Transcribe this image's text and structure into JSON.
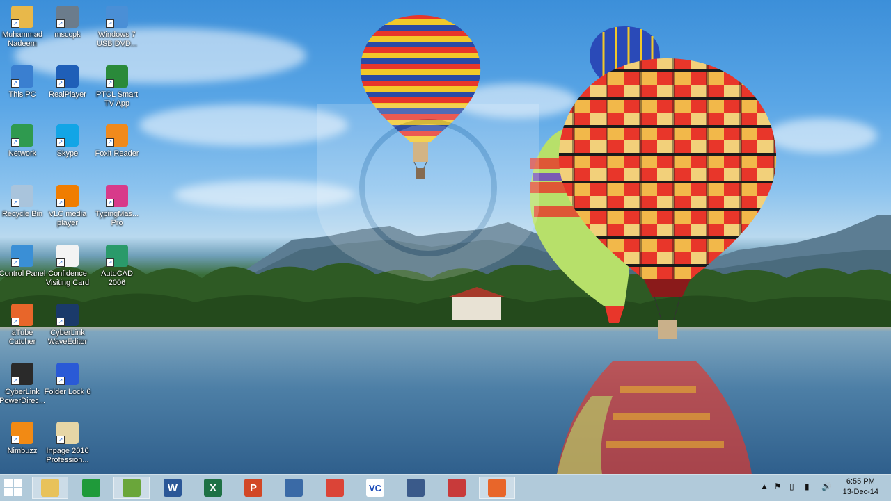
{
  "desktop": {
    "icons": [
      {
        "label": "Muhammad Nadeem",
        "icon": "user-folder-icon",
        "color": "#e8b84a"
      },
      {
        "label": "msccpk",
        "icon": "webcam-icon",
        "color": "#6b7c8c"
      },
      {
        "label": "Windows 7 USB DVD...",
        "icon": "usb-dvd-tool-icon",
        "color": "#4a8fd6"
      },
      {
        "label": "This PC",
        "icon": "computer-icon",
        "color": "#3a7fd0"
      },
      {
        "label": "RealPlayer",
        "icon": "realplayer-icon",
        "color": "#1f5fb8"
      },
      {
        "label": "PTCL Smart TV App",
        "icon": "ptcl-tv-icon",
        "color": "#2a8a3a"
      },
      {
        "label": "Network",
        "icon": "network-globe-icon",
        "color": "#2f9a4f"
      },
      {
        "label": "Skype",
        "icon": "skype-icon",
        "color": "#12a5e6"
      },
      {
        "label": "Foxit Reader",
        "icon": "foxit-reader-icon",
        "color": "#f08a1c"
      },
      {
        "label": "Recycle Bin",
        "icon": "recycle-bin-icon",
        "color": "#a9c4dc"
      },
      {
        "label": "VLC media player",
        "icon": "vlc-icon",
        "color": "#f07d00"
      },
      {
        "label": "TypingMas... Pro",
        "icon": "typingmaster-icon",
        "color": "#d83a8a"
      },
      {
        "label": "Control Panel",
        "icon": "control-panel-icon",
        "color": "#3a8fd6"
      },
      {
        "label": "Confidence Visiting Card",
        "icon": "visiting-card-icon",
        "color": "#f3f3f3"
      },
      {
        "label": "AutoCAD 2006",
        "icon": "autocad-icon",
        "color": "#2a9a6a"
      },
      {
        "label": "aTube Catcher",
        "icon": "atube-catcher-icon",
        "color": "#e8662a"
      },
      {
        "label": "CyberLink WaveEditor",
        "icon": "waveeditor-icon",
        "color": "#1a3a6a"
      },
      {
        "label": "CyberLink PowerDirec...",
        "icon": "powerdirector-icon",
        "color": "#2a2a2a"
      },
      {
        "label": "Folder Lock 6",
        "icon": "folder-lock-icon",
        "color": "#2a5ad6"
      },
      {
        "label": "Nimbuzz",
        "icon": "nimbuzz-icon",
        "color": "#f28a14"
      },
      {
        "label": "Inpage 2010 Profession...",
        "icon": "inpage-icon",
        "color": "#e6d6a6"
      }
    ]
  },
  "taskbar": {
    "start_icon": "windows-start-icon",
    "pinned": [
      {
        "icon": "file-explorer-icon",
        "glyph": "",
        "color": "#e8c25a",
        "active": true
      },
      {
        "icon": "store-icon",
        "glyph": "",
        "color": "#1f9a3a",
        "active": false
      },
      {
        "icon": "camtasia-icon",
        "glyph": "",
        "color": "#6aa63a",
        "active": true
      },
      {
        "icon": "word-icon",
        "glyph": "W",
        "color": "#2b5797",
        "active": false
      },
      {
        "icon": "excel-icon",
        "glyph": "X",
        "color": "#1e7145",
        "active": false
      },
      {
        "icon": "powerpoint-icon",
        "glyph": "P",
        "color": "#d24726",
        "active": false
      },
      {
        "icon": "media-player-icon",
        "glyph": "",
        "color": "#3a6aa6",
        "active": false
      },
      {
        "icon": "chrome-icon",
        "glyph": "",
        "color": "#db4437",
        "active": false
      },
      {
        "icon": "vc-icon",
        "glyph": "VC",
        "color": "#ffffff",
        "active": false
      },
      {
        "icon": "slideshow-icon",
        "glyph": "",
        "color": "#3a5a8a",
        "active": false
      },
      {
        "icon": "snipping-tool-icon",
        "glyph": "",
        "color": "#c83a3a",
        "active": false
      },
      {
        "icon": "atube-catcher-taskbar-icon",
        "glyph": "",
        "color": "#e8662a",
        "active": true
      }
    ],
    "tray": {
      "icons": [
        "show-hidden-icons-icon",
        "action-center-flag-icon",
        "devices-icon",
        "network-signal-icon",
        "volume-icon"
      ],
      "time": "6:55 PM",
      "date": "13-Dec-14"
    }
  }
}
